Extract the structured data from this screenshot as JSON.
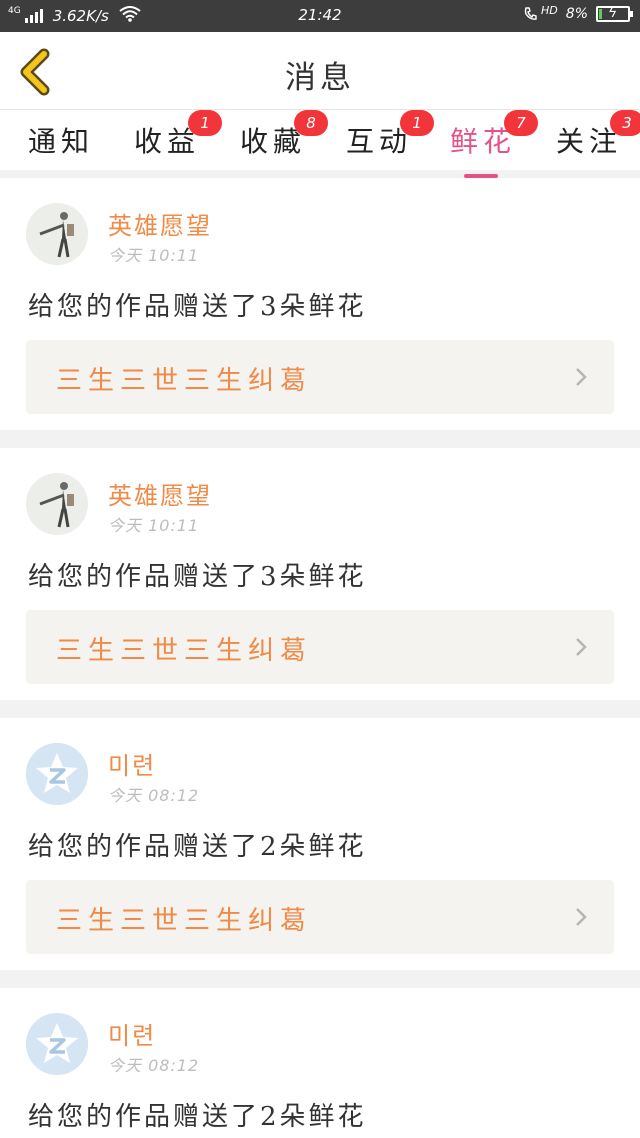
{
  "status_bar": {
    "network": "4G",
    "speed": "3.62K/s",
    "time": "21:42",
    "hd_label": "HD",
    "battery": "8%"
  },
  "header": {
    "title": "消息"
  },
  "tabs": [
    {
      "label": "通知",
      "badge": ""
    },
    {
      "label": "收益",
      "badge": "1"
    },
    {
      "label": "收藏",
      "badge": "8"
    },
    {
      "label": "互动",
      "badge": "1"
    },
    {
      "label": "鲜花",
      "badge": "7",
      "active": true
    },
    {
      "label": "关注",
      "badge": "3"
    }
  ],
  "messages": [
    {
      "user": "英雄愿望",
      "time": "今天 10:11",
      "text": "给您的作品赠送了3朵鲜花",
      "work": "三生三世三生纠葛",
      "avatar": "photo"
    },
    {
      "user": "英雄愿望",
      "time": "今天 10:11",
      "text": "给您的作品赠送了3朵鲜花",
      "work": "三生三世三生纠葛",
      "avatar": "photo"
    },
    {
      "user": "미련",
      "time": "今天 08:12",
      "text": "给您的作品赠送了2朵鲜花",
      "work": "三生三世三生纠葛",
      "avatar": "default"
    },
    {
      "user": "미련",
      "time": "今天 08:12",
      "text": "给您的作品赠送了2朵鲜花",
      "work": "",
      "avatar": "default"
    }
  ],
  "colors": {
    "accent_pink": "#e4528a",
    "name_orange": "#f08a46",
    "badge_red": "#f1353a",
    "back_arrow_yellow": "#f5c51d"
  }
}
